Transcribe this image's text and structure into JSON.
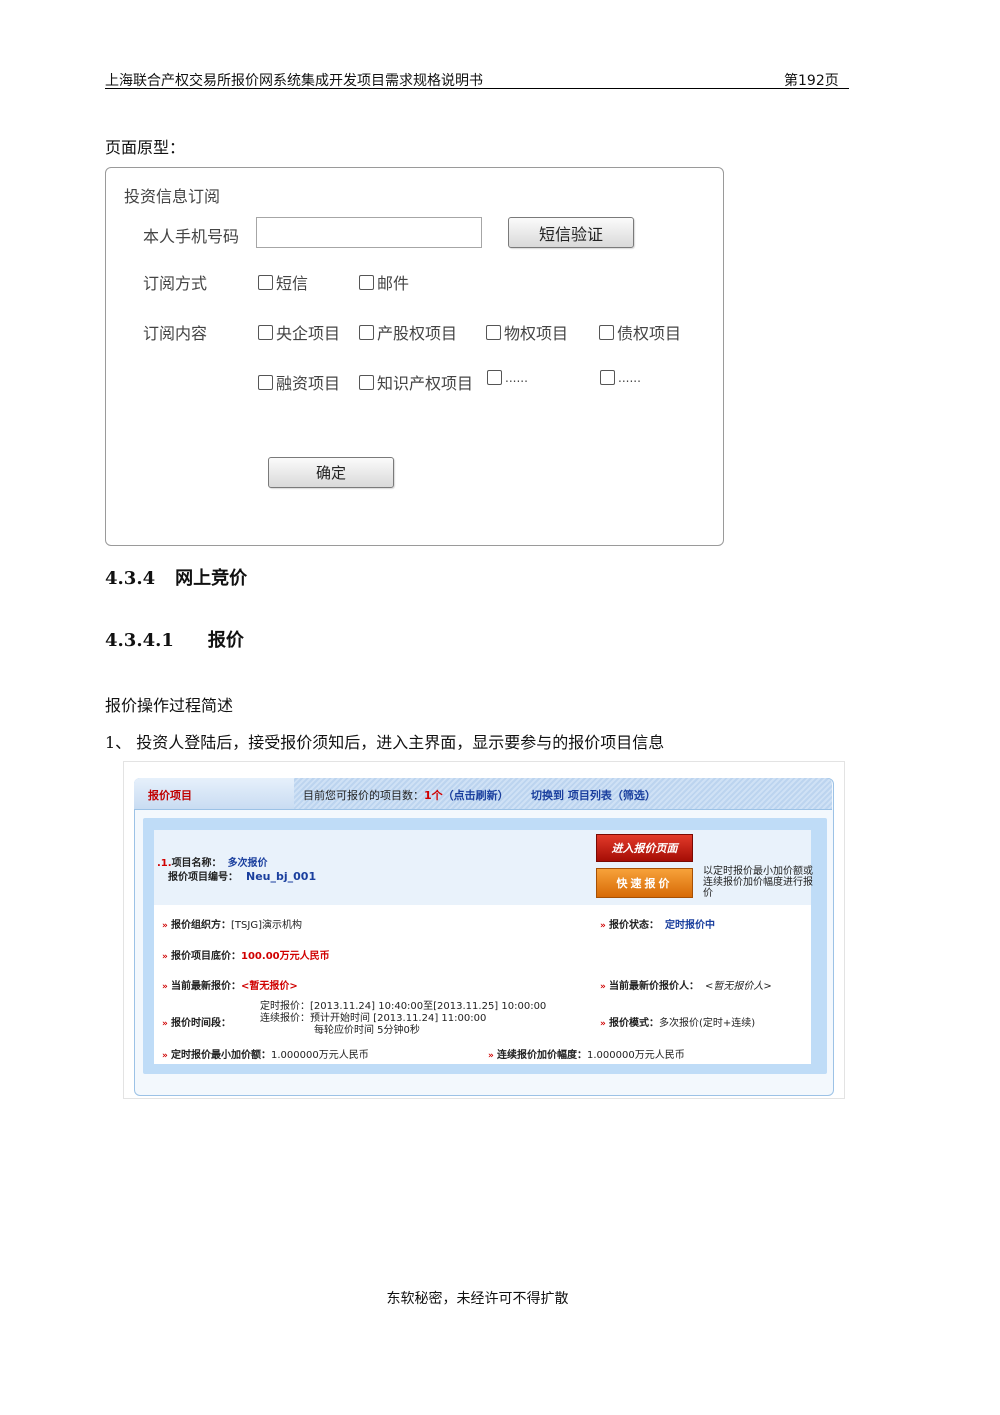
{
  "header": {
    "title": "上海联合产权交易所报价网系统集成开发项目需求规格说明书",
    "page": "第192页"
  },
  "prototype_label": "页面原型：",
  "subscribe_form": {
    "title": "投资信息订阅",
    "phone_label": "本人手机号码",
    "phone_value": "",
    "sms_button": "短信验证",
    "method_label": "订阅方式",
    "methods": [
      "短信",
      "邮件"
    ],
    "content_label": "订阅内容",
    "contents_row1": [
      "央企项目",
      "产股权项目",
      "物权项目",
      "债权项目"
    ],
    "contents_row2": [
      "融资项目",
      "知识产权项目",
      "......",
      "......"
    ],
    "confirm_button": "确定"
  },
  "heading1": {
    "number": "4.3.4",
    "text": "网上竞价"
  },
  "heading2": {
    "number": "4.3.4.1",
    "text": "报价"
  },
  "intro": "报价操作过程简述",
  "step1": "1、 投资人登陆后，接受报价须知后，进入主界面，显示要参与的报价项目信息",
  "quote_panel": {
    "title": "报价项目",
    "count_prefix": "目前您可报价的项目数：",
    "count_value": "1个",
    "refresh": "（点击刷新）",
    "switch_text": "切换到 项目列表（筛选）",
    "item_index": ".1.",
    "name_label": "项目名称：",
    "name_value": "多次报价",
    "code_label": "报价项目编号：",
    "code_value": "Neu_bj_001",
    "enter_button": "进入报价页面",
    "fast_button": "快速报价",
    "fast_hint": "以定时报价最小加价额或连续报价加价幅度进行报价",
    "org_label": "报价组织方：",
    "org_value": "[TSJG]演示机构",
    "status_label": "报价状态：",
    "status_value": "定时报价中",
    "base_label": "报价项目底价：",
    "base_value": "100.00万元人民币",
    "latest_label": "当前最新报价：",
    "latest_value": "<暂无报价>",
    "latest_person_label": "当前最新价报价人：",
    "latest_person_value": "<暂无报价人>",
    "time_label": "报价时间段：",
    "time_line1": "定时报价：[2013.11.24] 10:40:00至[2013.11.25] 10:00:00",
    "time_line2": "连续报价：预计开始时间 [2013.11.24] 11:00:00",
    "time_line3": "每轮应价时间 5分钟0秒",
    "mode_label": "报价模式：",
    "mode_value": "多次报价(定时+连续)",
    "min_inc_label": "定时报价最小加价额：",
    "min_inc_value": "1.000000万元人民币",
    "cont_inc_label": "连续报价加价幅度：",
    "cont_inc_value": "1.000000万元人民币"
  },
  "footer": "东软秘密，未经许可不得扩散"
}
